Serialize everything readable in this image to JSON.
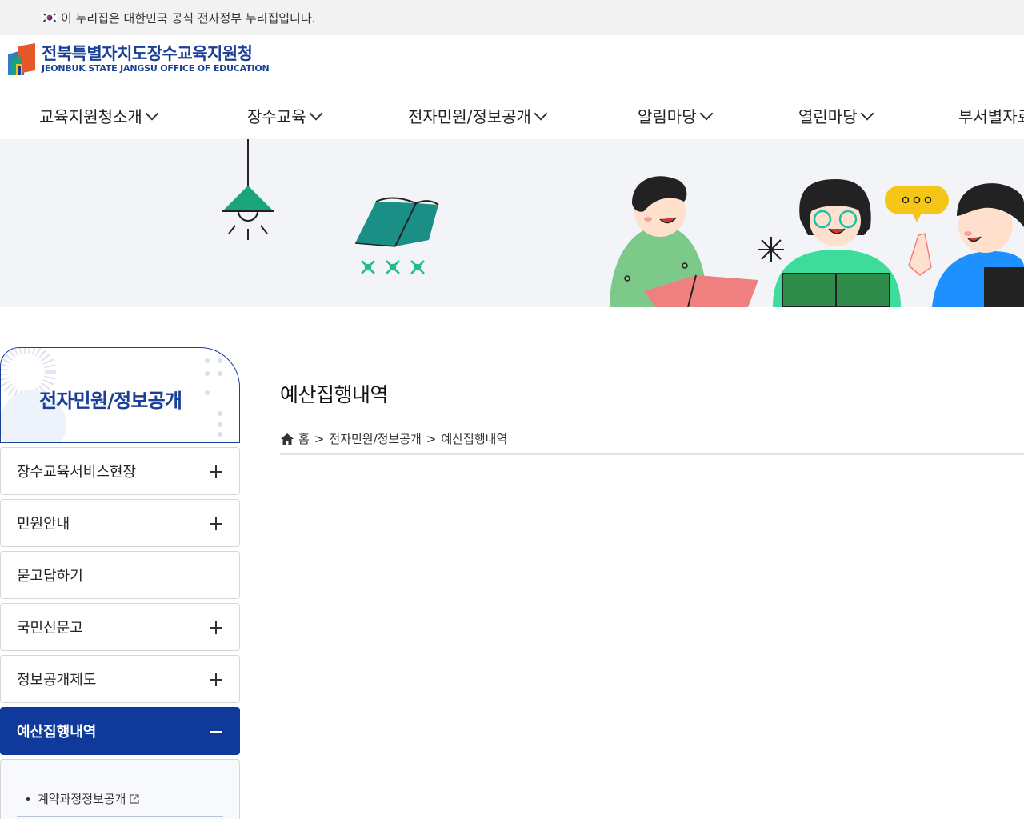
{
  "gov_banner": {
    "text": "이 누리집은 대한민국 공식 전자정부 누리집입니다."
  },
  "logo": {
    "title": "전북특별자치도장수교육지원청",
    "subtitle": "JEONBUK STATE JANGSU OFFICE OF EDUCATION"
  },
  "gnb": {
    "items": [
      {
        "label": "교육지원청소개"
      },
      {
        "label": "장수교육"
      },
      {
        "label": "전자민원/정보공개"
      },
      {
        "label": "알림마당"
      },
      {
        "label": "열린마당"
      },
      {
        "label": "부서별자료"
      }
    ]
  },
  "lnb": {
    "title": "전자민원/정보공개",
    "items": [
      {
        "label": "장수교육서비스현장",
        "expandable": true
      },
      {
        "label": "민원안내",
        "expandable": true
      },
      {
        "label": "묻고답하기",
        "expandable": false
      },
      {
        "label": "국민신문고",
        "expandable": true
      },
      {
        "label": "정보공개제도",
        "expandable": true
      },
      {
        "label": "예산집행내역",
        "expandable": true,
        "active": true
      }
    ],
    "sub_items": [
      {
        "label": "계약과정정보공개",
        "external": true
      }
    ]
  },
  "content": {
    "title": "예산집행내역",
    "breadcrumb": [
      "홈",
      "전자민원/정보공개",
      "예산집행내역"
    ],
    "breadcrumb_sep": ">"
  },
  "colors": {
    "brand": "#1a3f97",
    "active_menu": "#0f3a9c",
    "banner_bg": "#f2f4f7",
    "gov_bar_bg": "#f2f2f2"
  },
  "visual": {
    "speech_bubble": "ㅇㅇㅇ"
  }
}
